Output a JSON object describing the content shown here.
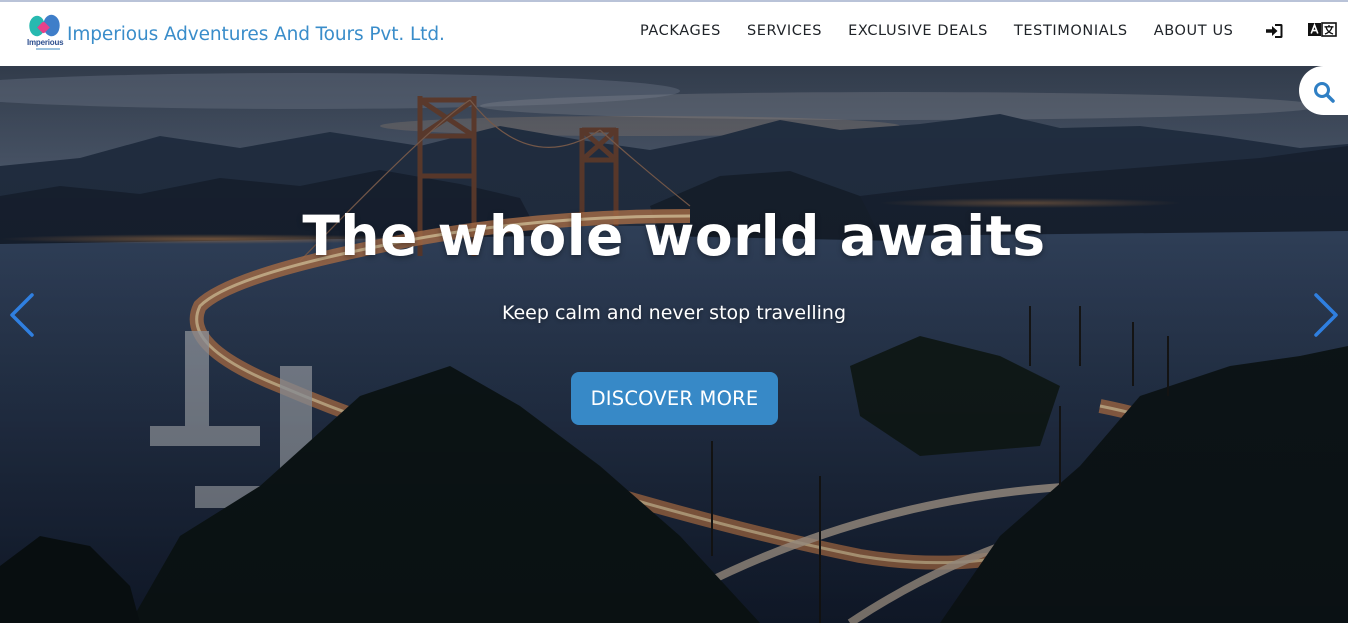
{
  "brand": {
    "logo_text": "Imperious",
    "name": "Imperious Adventures And Tours Pvt. Ltd."
  },
  "nav": {
    "items": [
      {
        "label": "PACKAGES"
      },
      {
        "label": "SERVICES"
      },
      {
        "label": "EXCLUSIVE DEALS"
      },
      {
        "label": "TESTIMONIALS"
      },
      {
        "label": "ABOUT US"
      }
    ],
    "icons": [
      "login-icon",
      "translate-icon"
    ]
  },
  "hero": {
    "title": "The whole world awaits",
    "subtitle": "Keep calm and never stop travelling",
    "cta_label": "DISCOVER MORE",
    "icons": [
      "chevron-left-icon",
      "chevron-right-icon",
      "search-icon"
    ]
  },
  "colors": {
    "brand_blue": "#3a8dca",
    "cta_blue": "#3789c7",
    "arrow_blue": "#2f7fe0",
    "nav_text": "#1f2328"
  }
}
